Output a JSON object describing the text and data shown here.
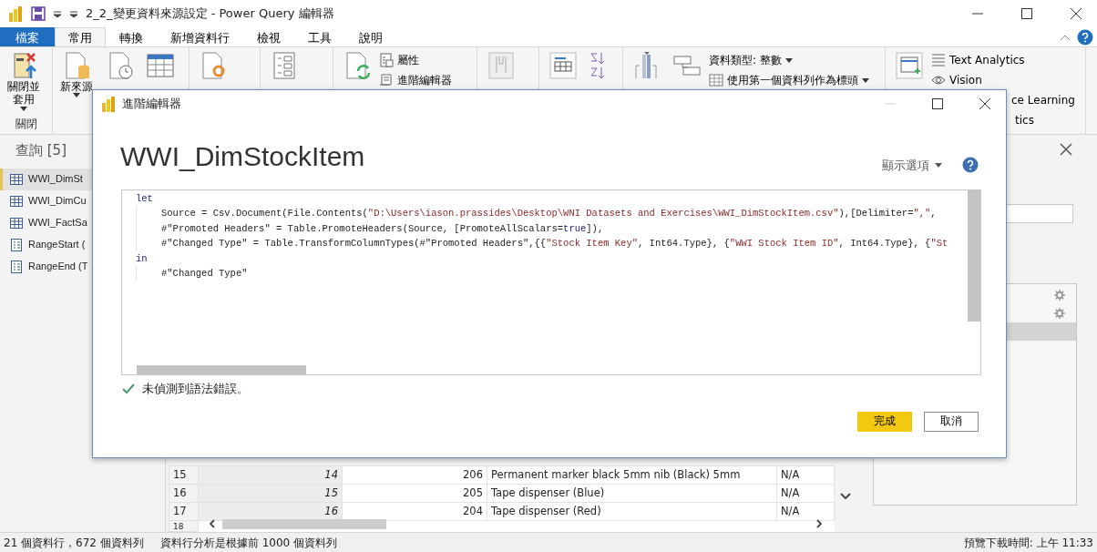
{
  "window": {
    "title": "2_2_變更資料來源設定 - Power Query 編輯器"
  },
  "tabs": [
    {
      "label": "檔案",
      "kind": "file",
      "selected": false
    },
    {
      "label": "常用",
      "kind": "tab",
      "selected": true
    },
    {
      "label": "轉換",
      "kind": "tab",
      "selected": false
    },
    {
      "label": "新增資料行",
      "kind": "tab",
      "selected": false
    },
    {
      "label": "檢視",
      "kind": "tab",
      "selected": false
    },
    {
      "label": "工具",
      "kind": "tab",
      "selected": false
    },
    {
      "label": "說明",
      "kind": "tab",
      "selected": false
    }
  ],
  "ribbon": {
    "group_label": "關閉",
    "large_buttons": [
      {
        "label": "關閉並套用",
        "dropdown": true
      },
      {
        "label": "新來源",
        "dropdown": true
      }
    ],
    "small_buttons": [
      {
        "label": "屬性",
        "dropdown": false
      },
      {
        "label": "進階編輯器",
        "dropdown": false
      },
      {
        "label": "資料類型: 整數",
        "dropdown": true
      },
      {
        "label": "使用第一個資料列作為標頭",
        "dropdown": true
      },
      {
        "label": "Text Analytics",
        "dropdown": false
      },
      {
        "label": "Vision",
        "dropdown": false
      },
      {
        "label": "ce Learning",
        "dropdown": false
      },
      {
        "label": "tics",
        "dropdown": false
      }
    ]
  },
  "queries": {
    "title": "查詢 [5]",
    "items": [
      {
        "label": "WWI_DimSt",
        "kind": "table",
        "selected": true
      },
      {
        "label": "WWI_DimCu",
        "kind": "table",
        "selected": false
      },
      {
        "label": "WWI_FactSa",
        "kind": "table",
        "selected": false
      },
      {
        "label": "RangeStart (",
        "kind": "parameter",
        "selected": false
      },
      {
        "label": "RangeEnd (T",
        "kind": "parameter",
        "selected": false
      }
    ]
  },
  "table": {
    "rows": [
      [
        "15",
        "14",
        "206",
        "Permanent marker black 5mm nib (Black) 5mm",
        "N/A"
      ],
      [
        "16",
        "15",
        "205",
        "Tape dispenser (Blue)",
        "N/A"
      ],
      [
        "17",
        "16",
        "204",
        "Tape dispenser (Red)",
        "N/A"
      ],
      [
        "18"
      ]
    ]
  },
  "settings_list": [
    {
      "kind": "gear",
      "selected": false
    },
    {
      "kind": "gear",
      "selected": false
    },
    {
      "kind": "plain",
      "selected": true
    }
  ],
  "status_bar": {
    "left": [
      "21 個資料行，672 個資料列",
      "資料行分析是根據前 1000 個資料列"
    ],
    "right": "預覽下載時間: 上午 11:33"
  },
  "dialog": {
    "title": "進階編輯器",
    "controls": [
      {
        "kind": "minimize",
        "disabled": true
      },
      {
        "kind": "maximize",
        "disabled": false
      },
      {
        "kind": "close",
        "disabled": false
      }
    ],
    "heading": "WWI_DimStockItem",
    "options": "顯示選項",
    "code": [
      {
        "keyword": "let",
        "lines": [
          [
            {
              "kind": "plain",
              "text": "Source = Csv.Document(File.Contents("
            },
            {
              "kind": "string",
              "text": "\"D:\\Users\\iason.prassides\\Desktop\\WNI Datasets and Exercises\\WWI_DimStockItem.csv\""
            },
            {
              "kind": "plain",
              "text": "),[Delimiter="
            },
            {
              "kind": "string",
              "text": "\",\""
            },
            {
              "kind": "plain",
              "text": ","
            }
          ],
          [
            {
              "kind": "plain",
              "text": "#\"Promoted Headers\" = Table.PromoteHeaders(Source, [PromoteAllScalars="
            },
            {
              "kind": "keyword",
              "text": "true"
            },
            {
              "kind": "plain",
              "text": "]),"
            }
          ],
          [
            {
              "kind": "plain",
              "text": "#\"Changed Type\" = Table.TransformColumnTypes(#\"Promoted Headers\",{{"
            },
            {
              "kind": "string",
              "text": "\"Stock Item Key\""
            },
            {
              "kind": "plain",
              "text": ", Int64.Type}, {"
            },
            {
              "kind": "string",
              "text": "\"WWI Stock Item ID\""
            },
            {
              "kind": "plain",
              "text": ", Int64.Type}, {"
            },
            {
              "kind": "string",
              "text": "\"St"
            }
          ]
        ]
      },
      {
        "keyword": "in",
        "lines": [
          [
            {
              "kind": "plain",
              "text": "#\"Changed Type\""
            }
          ]
        ]
      }
    ],
    "message": "未偵測到語法錯誤。",
    "buttons": [
      {
        "label": "完成",
        "kind": "primary"
      },
      {
        "label": "取消",
        "kind": "secondary"
      }
    ]
  }
}
